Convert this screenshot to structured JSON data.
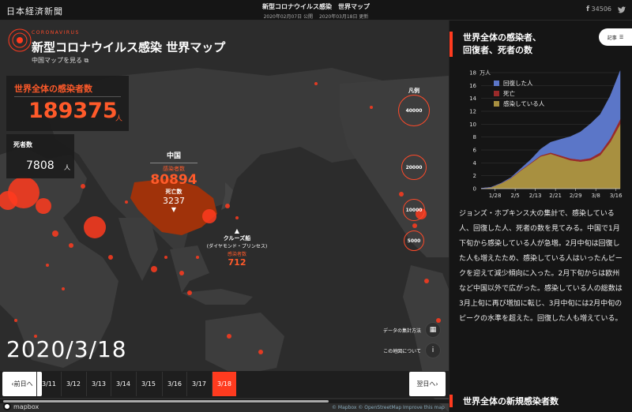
{
  "header": {
    "logo": "日本経済新聞",
    "title": "新型コロナウイルス感染　世界マップ",
    "published": "2020年02月07日 公開",
    "updated": "2020年03月18日 更新",
    "share_count": "34506"
  },
  "brand": {
    "tag": "CORONAVIRUS",
    "title": "新型コロナウイルス感染 世界マップ",
    "china_link": "中国マップを見る"
  },
  "totals": {
    "infected_label": "世界全体の感染者数",
    "infected_value": "189375",
    "infected_unit": "人",
    "death_label": "死者数",
    "death_value": "7808",
    "death_unit": "人"
  },
  "china": {
    "name": "中国",
    "infected_label": "感染者数",
    "infected_value": "80894",
    "death_label": "死亡数",
    "death_value": "3237"
  },
  "cruise": {
    "name": "クルーズ船",
    "sub": "(ダイヤモンド・プリンセス)",
    "infected_label": "感染者数",
    "infected_value": "712"
  },
  "legend": {
    "title": "凡例",
    "values": [
      "40000",
      "20000",
      "10000",
      "5000"
    ]
  },
  "info": {
    "method_label": "データの集計方法",
    "about_label": "この地図について"
  },
  "current_date": "2020/3/18",
  "timeline": {
    "prev": "前日へ",
    "next": "翌日へ",
    "days": [
      "3/11",
      "3/12",
      "3/13",
      "3/14",
      "3/15",
      "3/16",
      "3/17",
      "3/18"
    ],
    "active_day": "3/18"
  },
  "footer": {
    "mapbox": "mapbox",
    "attribution": "© Mapbox © OpenStreetMap Improve this map"
  },
  "panel": {
    "title_line1": "世界全体の感染者、",
    "title_line2": "回復者、死者の数",
    "kiji_label": "記事",
    "description": "ジョンズ・ホプキンス大の集計で、感染している人、回復した人、死者の数を見てみる。中国で1月下旬から感染している人が急増。2月中旬は回復した人も増えたため、感染している人はいったんピークを迎えて減少傾向に入った。2月下旬からは欧州など中国以外で広がった。感染している人の総数は3月上旬に再び増加に転じ、3月中旬には2月中旬のピークの水準を超えた。回復した人も増えている。",
    "next_title": "世界全体の新規感染者数"
  },
  "colors": {
    "accent": "#ff3b1f",
    "recovered": "#5b76c8",
    "deaths": "#9a2a2a",
    "active": "#a89040"
  },
  "chart_data": {
    "type": "area",
    "stacked": true,
    "y_unit_label": "万人",
    "ylim": [
      0,
      18
    ],
    "y_ticks": [
      0,
      2,
      4,
      6,
      8,
      10,
      12,
      14,
      16,
      18
    ],
    "x_ticks": [
      "1/28",
      "2/5",
      "2/13",
      "2/21",
      "2/29",
      "3/8",
      "3/16"
    ],
    "x": [
      "1/22",
      "1/26",
      "1/30",
      "2/3",
      "2/7",
      "2/11",
      "2/15",
      "2/19",
      "2/23",
      "2/27",
      "3/2",
      "3/6",
      "3/10",
      "3/14",
      "3/18"
    ],
    "series": [
      {
        "name": "感染している人",
        "values": [
          0.05,
          0.2,
          0.8,
          1.6,
          2.8,
          3.9,
          5.0,
          5.4,
          4.9,
          4.4,
          4.2,
          4.4,
          5.2,
          7.2,
          10.0
        ]
      },
      {
        "name": "死亡",
        "values": [
          0.0,
          0.01,
          0.02,
          0.04,
          0.07,
          0.1,
          0.15,
          0.2,
          0.25,
          0.28,
          0.3,
          0.34,
          0.42,
          0.57,
          0.78
        ]
      },
      {
        "name": "回復した人",
        "values": [
          0.0,
          0.0,
          0.02,
          0.08,
          0.25,
          0.5,
          1.0,
          1.6,
          2.5,
          3.4,
          4.3,
          5.3,
          5.9,
          6.6,
          7.5
        ]
      }
    ],
    "legend": [
      "回復した人",
      "死亡",
      "感染している人"
    ],
    "legend_position": "top-left"
  }
}
